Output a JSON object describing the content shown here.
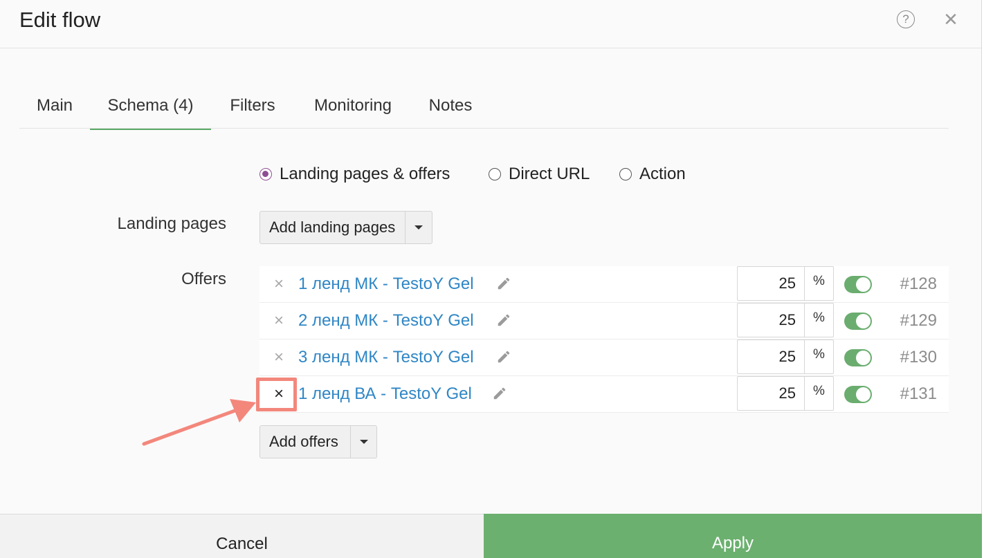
{
  "dialog": {
    "title": "Edit flow",
    "help_icon": "help-circle-icon",
    "help_symbol": "?",
    "close_icon": "close-icon",
    "close_symbol": "✕"
  },
  "tabs": [
    {
      "label": "Main",
      "active": false
    },
    {
      "label": "Schema (4)",
      "active": true
    },
    {
      "label": "Filters",
      "active": false
    },
    {
      "label": "Monitoring",
      "active": false
    },
    {
      "label": "Notes",
      "active": false
    }
  ],
  "schema_types": [
    {
      "label": "Landing pages & offers",
      "checked": true
    },
    {
      "label": "Direct URL",
      "checked": false
    },
    {
      "label": "Action",
      "checked": false
    }
  ],
  "landing_pages": {
    "label": "Landing pages",
    "add_button": "Add landing pages"
  },
  "offers": {
    "label": "Offers",
    "add_button": "Add offers",
    "remove_symbol": "×",
    "percent_unit": "%",
    "items": [
      {
        "name": "1 ленд МК - TestoY Gel",
        "share": "25",
        "enabled": true,
        "id": "#128"
      },
      {
        "name": "2 ленд МК - TestoY Gel",
        "share": "25",
        "enabled": true,
        "id": "#129"
      },
      {
        "name": "3 ленд МК - TestoY Gel",
        "share": "25",
        "enabled": true,
        "id": "#130"
      },
      {
        "name": "1 ленд ВА - TestoY Gel",
        "share": "25",
        "enabled": true,
        "id": "#131"
      }
    ]
  },
  "footer": {
    "cancel": "Cancel",
    "apply": "Apply"
  },
  "colors": {
    "accent_green": "#6bb06f",
    "link_blue": "#2f86c5",
    "radio_purple": "#8e4d92",
    "annotation_salmon": "#f3877c"
  }
}
